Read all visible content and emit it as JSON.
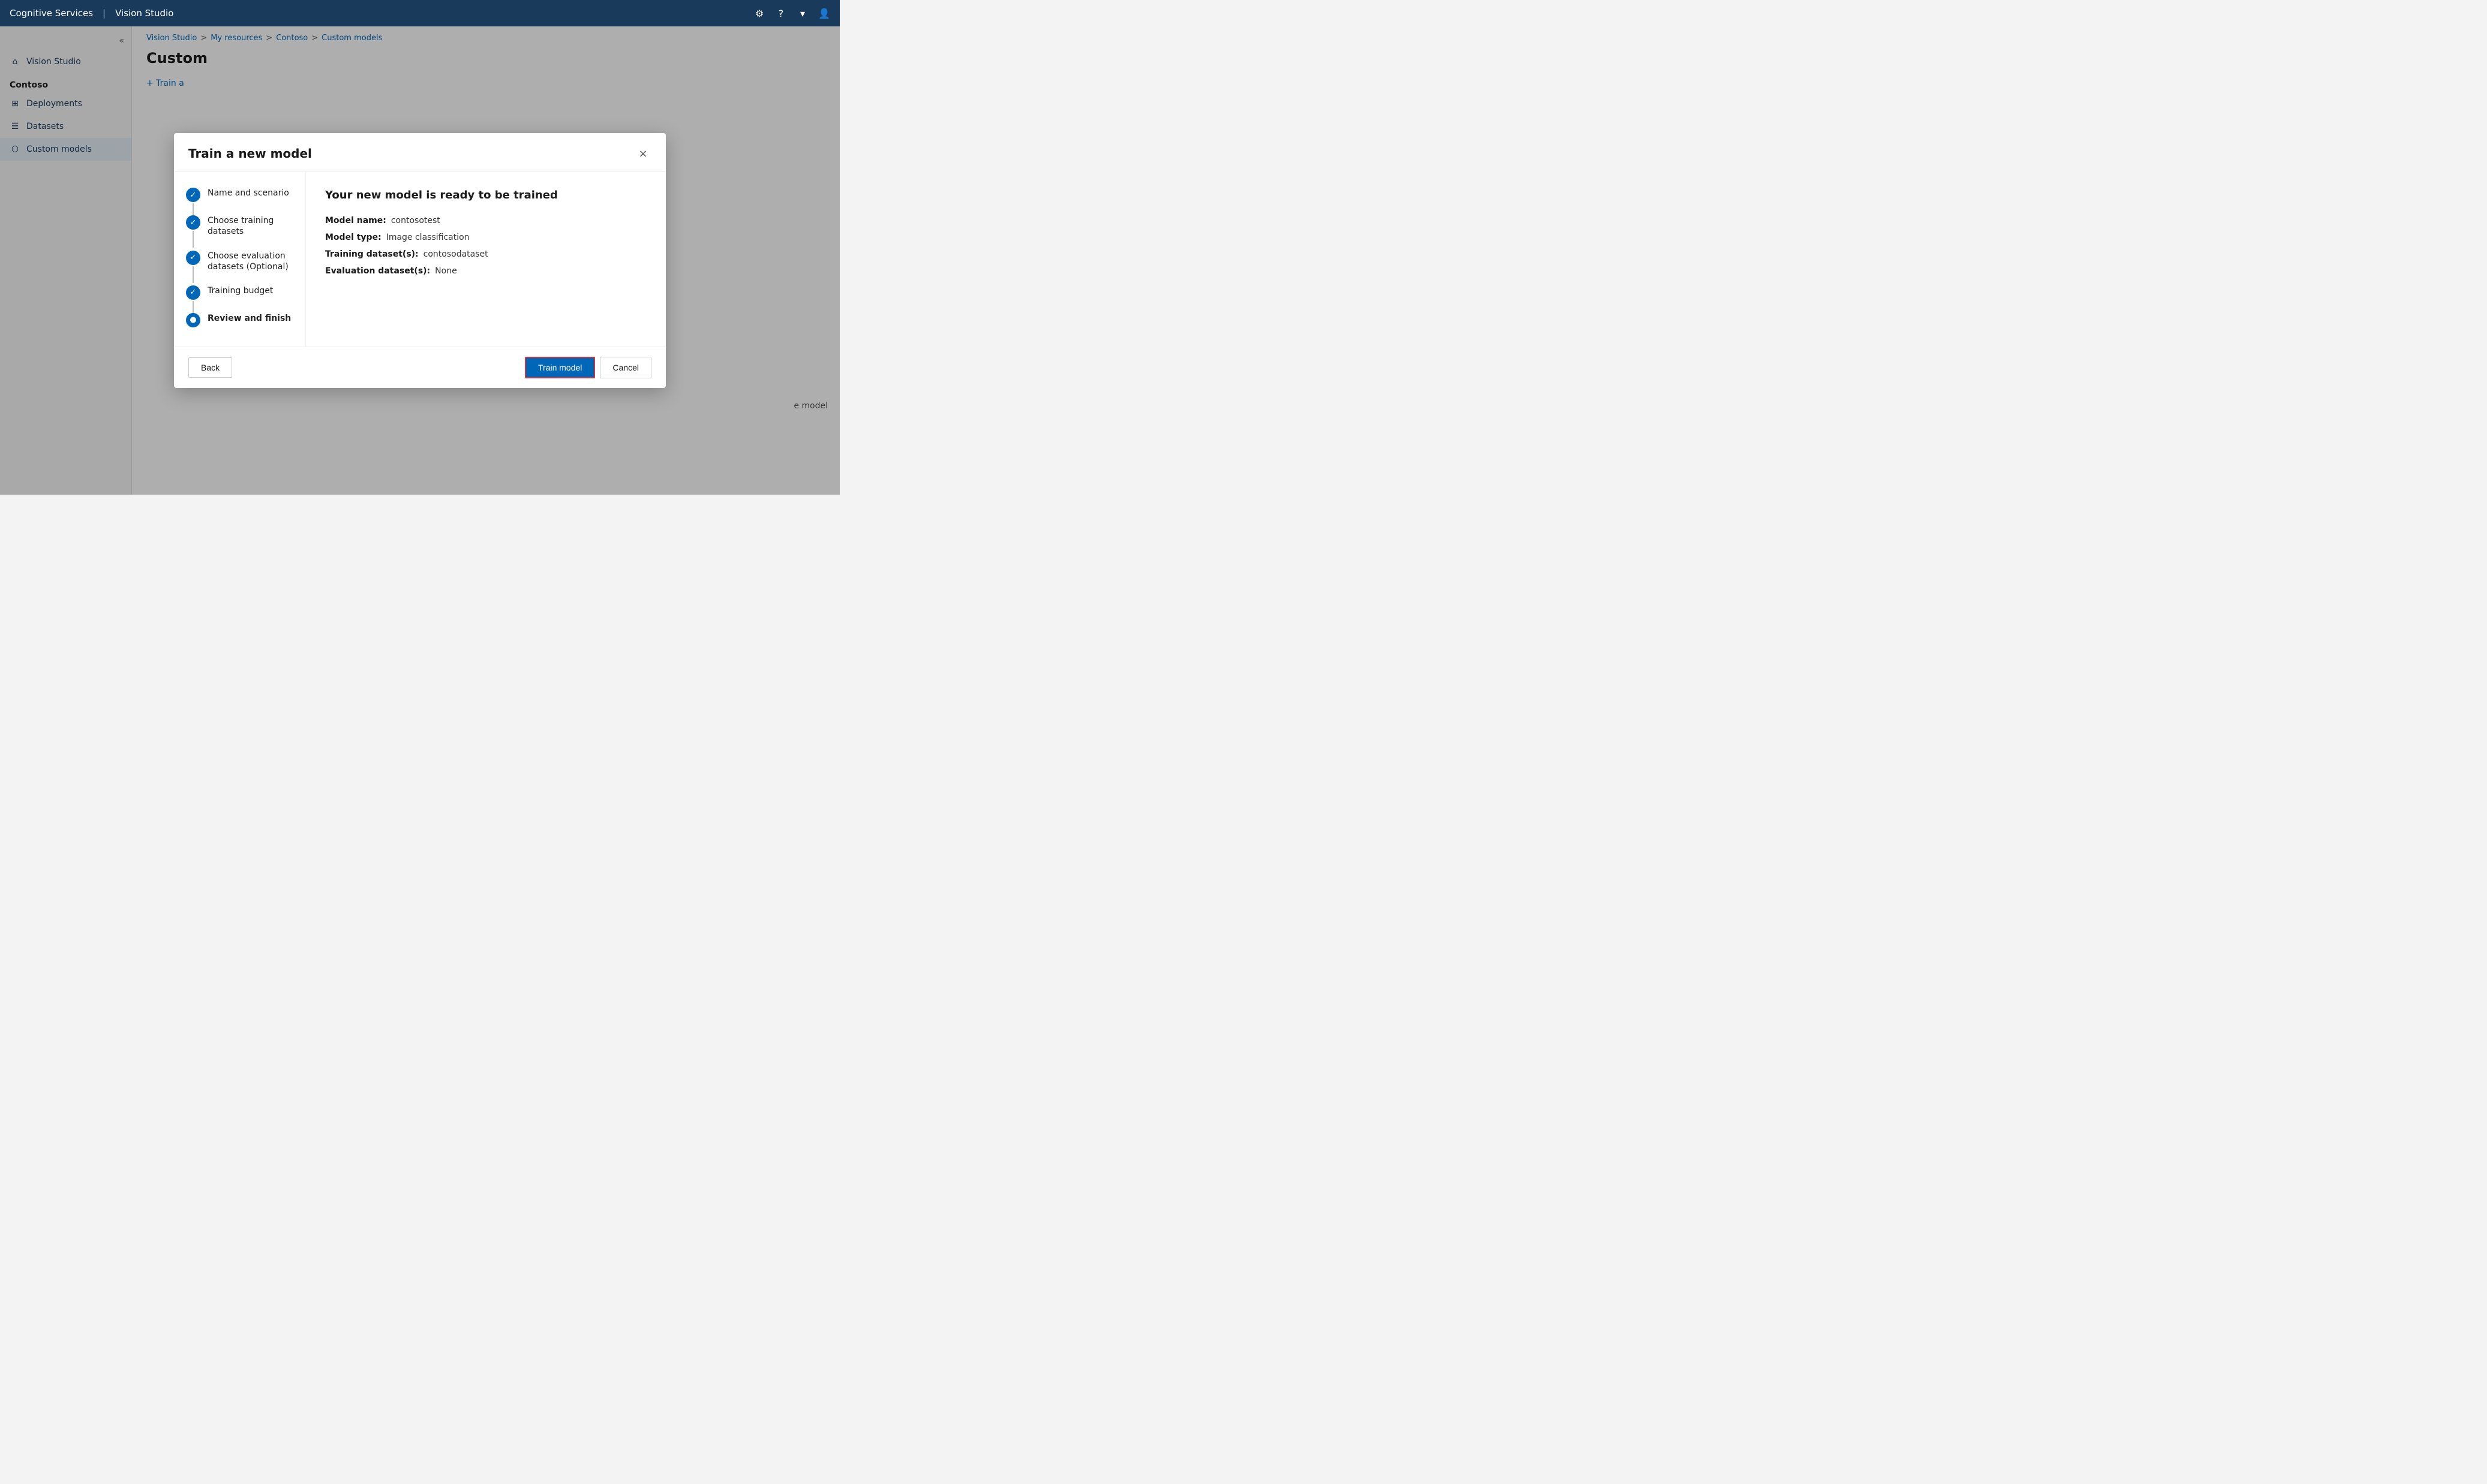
{
  "topbar": {
    "brand": "Cognitive Services",
    "divider": "|",
    "app": "Vision Studio",
    "icons": {
      "settings": "⚙",
      "help": "?",
      "dropdown": "▾",
      "user": "👤"
    }
  },
  "sidebar": {
    "collapse_icon": "«",
    "nav_item_home_label": "Vision Studio",
    "section_label": "Contoso",
    "nav_items": [
      {
        "id": "deployments",
        "label": "Deployments",
        "icon": "⊞"
      },
      {
        "id": "datasets",
        "label": "Datasets",
        "icon": "☰"
      },
      {
        "id": "custom-models",
        "label": "Custom models",
        "icon": "⬡"
      }
    ]
  },
  "breadcrumb": {
    "items": [
      {
        "label": "Vision Studio"
      },
      {
        "label": "My resources"
      },
      {
        "label": "Contoso"
      },
      {
        "label": "Custom models"
      }
    ],
    "separator": ">"
  },
  "page": {
    "title": "Custom",
    "train_button_label": "+ Train a"
  },
  "bg_hint": "e model",
  "modal": {
    "title": "Train a new model",
    "close_label": "×",
    "steps": [
      {
        "id": "name-scenario",
        "label": "Name and scenario",
        "state": "completed"
      },
      {
        "id": "training-datasets",
        "label": "Choose training datasets",
        "state": "completed"
      },
      {
        "id": "evaluation-datasets",
        "label": "Choose evaluation datasets (Optional)",
        "state": "completed"
      },
      {
        "id": "training-budget",
        "label": "Training budget",
        "state": "completed"
      },
      {
        "id": "review-finish",
        "label": "Review and finish",
        "state": "active"
      }
    ],
    "content": {
      "heading": "Your new model is ready to be trained",
      "details": [
        {
          "label": "Model name:",
          "value": "contosotest"
        },
        {
          "label": "Model type:",
          "value": "Image classification"
        },
        {
          "label": "Training dataset(s):",
          "value": "contosodataset"
        },
        {
          "label": "Evaluation dataset(s):",
          "value": "None"
        }
      ]
    },
    "footer": {
      "back_label": "Back",
      "train_label": "Train model",
      "cancel_label": "Cancel"
    }
  }
}
